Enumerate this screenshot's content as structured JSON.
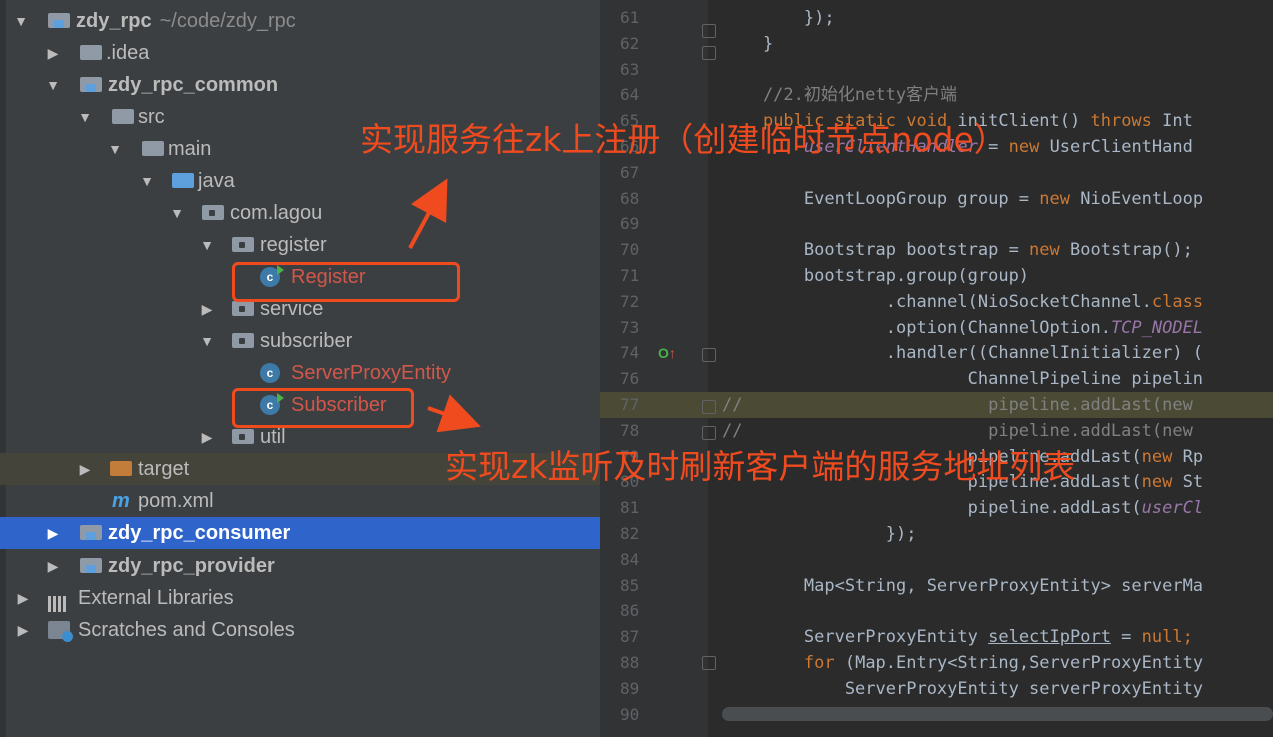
{
  "tree": {
    "root": {
      "name": "zdy_rpc",
      "path": "~/code/zdy_rpc"
    },
    "idea": ".idea",
    "common": "zdy_rpc_common",
    "src": "src",
    "main": "main",
    "java": "java",
    "pkg": "com.lagou",
    "register_pkg": "register",
    "register_cls": "Register",
    "service_pkg": "service",
    "subscriber_pkg": "subscriber",
    "server_proxy_cls": "ServerProxyEntity",
    "subscriber_cls": "Subscriber",
    "util_pkg": "util",
    "target": "target",
    "pom_icon": "m",
    "pom": "pom.xml",
    "consumer": "zdy_rpc_consumer",
    "provider": "zdy_rpc_provider",
    "libs": "External Libraries",
    "scratches": "Scratches and Consoles",
    "class_badge": "c"
  },
  "editor": {
    "lines": [
      {
        "n": "61",
        "segs": [
          {
            "t": "        });",
            "c": ""
          }
        ]
      },
      {
        "n": "62",
        "segs": [
          {
            "t": "    }",
            "c": ""
          }
        ]
      },
      {
        "n": "63",
        "segs": []
      },
      {
        "n": "64",
        "segs": [
          {
            "t": "    //2.初始化netty客户端",
            "c": "cm"
          }
        ]
      },
      {
        "n": "65",
        "segs": [
          {
            "t": "    ",
            "c": ""
          },
          {
            "t": "public static void ",
            "c": "kw"
          },
          {
            "t": "initClient() ",
            "c": ""
          },
          {
            "t": "throws ",
            "c": "kw"
          },
          {
            "t": "Int",
            "c": ""
          }
        ]
      },
      {
        "n": "66",
        "segs": [
          {
            "t": "        ",
            "c": ""
          },
          {
            "t": "userClientHandler",
            "c": "fld"
          },
          {
            "t": " = ",
            "c": ""
          },
          {
            "t": "new ",
            "c": "kw"
          },
          {
            "t": "UserClientHand",
            "c": ""
          }
        ]
      },
      {
        "n": "67",
        "segs": []
      },
      {
        "n": "68",
        "segs": [
          {
            "t": "        EventLoopGroup group = ",
            "c": ""
          },
          {
            "t": "new ",
            "c": "kw"
          },
          {
            "t": "NioEventLoop",
            "c": ""
          }
        ]
      },
      {
        "n": "69",
        "segs": []
      },
      {
        "n": "70",
        "segs": [
          {
            "t": "        Bootstrap bootstrap = ",
            "c": ""
          },
          {
            "t": "new ",
            "c": "kw"
          },
          {
            "t": "Bootstrap();",
            "c": ""
          }
        ]
      },
      {
        "n": "71",
        "segs": [
          {
            "t": "        bootstrap.group(group)",
            "c": ""
          }
        ]
      },
      {
        "n": "72",
        "segs": [
          {
            "t": "                .channel(NioSocketChannel.",
            "c": ""
          },
          {
            "t": "class",
            "c": "kw"
          }
        ]
      },
      {
        "n": "73",
        "segs": [
          {
            "t": "                .option(ChannelOption.",
            "c": ""
          },
          {
            "t": "TCP_NODEL",
            "c": "fld"
          }
        ]
      },
      {
        "n": "74",
        "segs": [
          {
            "t": "                .handler((ChannelInitializer) (",
            "c": ""
          }
        ]
      },
      {
        "n": "76",
        "segs": [
          {
            "t": "                        ChannelPipeline pipelin",
            "c": ""
          }
        ]
      },
      {
        "n": "77",
        "segs": [
          {
            "t": "//                        pipeline.addLast(new ",
            "c": "cm"
          }
        ]
      },
      {
        "n": "78",
        "segs": [
          {
            "t": "//                        pipeline.addLast(new ",
            "c": "cm"
          }
        ]
      },
      {
        "n": "79",
        "segs": [
          {
            "t": "                        pipeline.addLast(",
            "c": ""
          },
          {
            "t": "new ",
            "c": "kw"
          },
          {
            "t": "Rp",
            "c": ""
          }
        ]
      },
      {
        "n": "80",
        "segs": [
          {
            "t": "                        pipeline.addLast(",
            "c": ""
          },
          {
            "t": "new ",
            "c": "kw"
          },
          {
            "t": "St",
            "c": ""
          }
        ]
      },
      {
        "n": "81",
        "segs": [
          {
            "t": "                        pipeline.addLast(",
            "c": ""
          },
          {
            "t": "userCl",
            "c": "fld"
          }
        ]
      },
      {
        "n": "82",
        "segs": [
          {
            "t": "                });",
            "c": ""
          }
        ]
      },
      {
        "n": "84",
        "segs": []
      },
      {
        "n": "85",
        "segs": [
          {
            "t": "        Map<String, ServerProxyEntity> serverMa",
            "c": ""
          }
        ]
      },
      {
        "n": "86",
        "segs": []
      },
      {
        "n": "87",
        "segs": [
          {
            "t": "        ServerProxyEntity ",
            "c": ""
          },
          {
            "t": "selectIpPort",
            "c": "uline"
          },
          {
            "t": " = ",
            "c": ""
          },
          {
            "t": "null;",
            "c": "kw"
          }
        ]
      },
      {
        "n": "88",
        "segs": [
          {
            "t": "        ",
            "c": ""
          },
          {
            "t": "for ",
            "c": "kw"
          },
          {
            "t": "(Map.Entry<String,ServerProxyEntity",
            "c": ""
          }
        ]
      },
      {
        "n": "89",
        "segs": [
          {
            "t": "            ServerProxyEntity serverProxyEntity",
            "c": ""
          }
        ]
      },
      {
        "n": "90",
        "segs": []
      }
    ]
  },
  "annotations": {
    "top": "实现服务往zk上注册（创建临时节点node）",
    "bottom": "实现zk监听及时刷新客户端的服务地址列表"
  },
  "colors": {
    "annotation": "#f04b1f",
    "selection": "#2f65ca",
    "keyword": "#cc7832",
    "comment": "#808080",
    "field": "#9876aa"
  }
}
